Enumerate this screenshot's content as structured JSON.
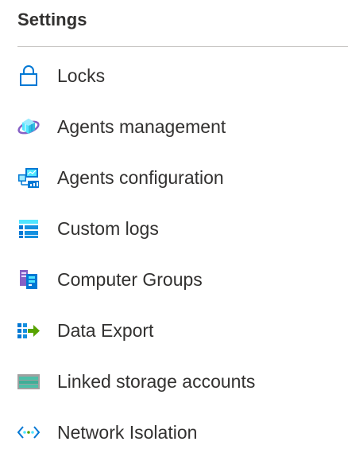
{
  "section": {
    "title": "Settings"
  },
  "menu": {
    "items": [
      {
        "label": "Locks",
        "icon": "lock-icon"
      },
      {
        "label": "Agents management",
        "icon": "agents-management-icon"
      },
      {
        "label": "Agents configuration",
        "icon": "agents-configuration-icon"
      },
      {
        "label": "Custom logs",
        "icon": "custom-logs-icon"
      },
      {
        "label": "Computer Groups",
        "icon": "computer-groups-icon"
      },
      {
        "label": "Data Export",
        "icon": "data-export-icon"
      },
      {
        "label": "Linked storage accounts",
        "icon": "storage-account-icon"
      },
      {
        "label": "Network Isolation",
        "icon": "network-isolation-icon"
      }
    ]
  },
  "colors": {
    "text": "#323130",
    "divider": "#c8c6c4",
    "accent_blue": "#0078d4",
    "export_green": "#57a300",
    "storage_green": "#4dbfa8",
    "groups_purple": "#8661c5"
  }
}
